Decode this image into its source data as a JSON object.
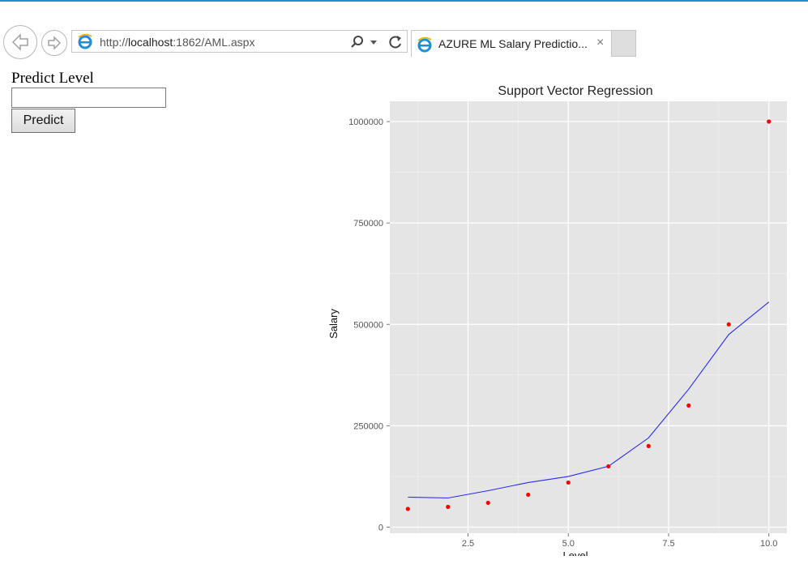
{
  "browser": {
    "back_icon": "back-arrow-icon",
    "forward_icon": "forward-arrow-icon",
    "url_prefix": "http://",
    "url_host": "localhost",
    "url_rest": ":1862/AML.aspx",
    "tab_title": "AZURE ML Salary Predictio...",
    "tab_close": "×",
    "search_icon": "search-icon",
    "refresh_icon": "refresh-icon"
  },
  "form": {
    "label": "Predict Level",
    "input_value": "",
    "button_label": "Predict"
  },
  "colors": {
    "panel": "#e5e5e5",
    "line": "#2a2af0",
    "points": "#ff0000",
    "accent": "#1e8fd6"
  },
  "chart_data": {
    "type": "scatter",
    "title": "Support Vector Regression",
    "xlabel": "Level",
    "ylabel": "Salary",
    "xlim": [
      0.55,
      10.45
    ],
    "ylim": [
      -15000,
      1050000
    ],
    "x_ticks": [
      2.5,
      5.0,
      7.5,
      10.0
    ],
    "x_tick_labels": [
      "2.5",
      "5.0",
      "7.5",
      "10.0"
    ],
    "y_ticks": [
      0,
      250000,
      500000,
      750000,
      1000000
    ],
    "y_tick_labels": [
      "0",
      "250000",
      "500000",
      "750000",
      "1000000"
    ],
    "grid": true,
    "series": [
      {
        "kind": "points",
        "x": [
          1,
          2,
          3,
          4,
          5,
          6,
          7,
          8,
          9,
          10
        ],
        "y": [
          45000,
          50000,
          60000,
          80000,
          110000,
          150000,
          200000,
          300000,
          500000,
          1000000
        ]
      },
      {
        "kind": "line",
        "x": [
          1,
          2,
          3,
          4,
          5,
          6,
          7,
          8,
          9,
          10
        ],
        "y": [
          74000,
          72000,
          90000,
          110000,
          125000,
          150000,
          220000,
          340000,
          475000,
          555000
        ]
      }
    ]
  }
}
